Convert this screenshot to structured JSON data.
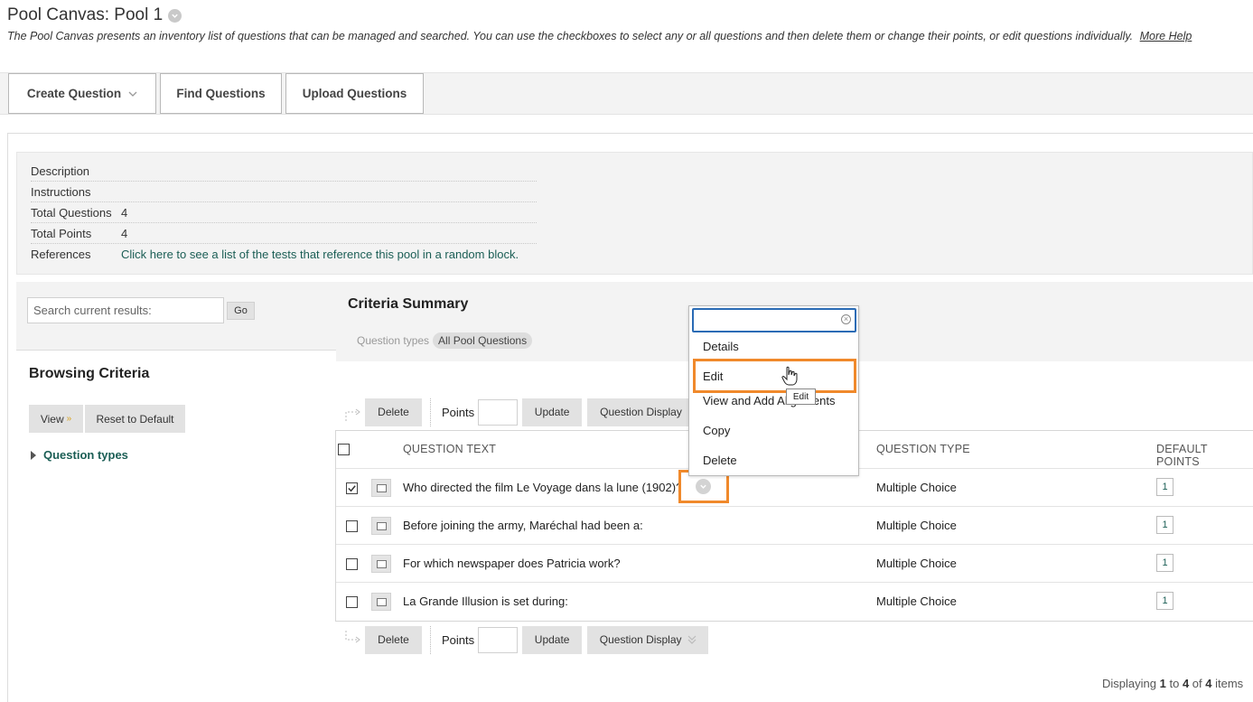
{
  "page": {
    "title": "Pool Canvas: Pool 1",
    "description": "The Pool Canvas presents an inventory list of questions that can be managed and searched. You can use the checkboxes to select any or all questions and then delete them or change their points, or edit questions individually.",
    "more_help": "More Help"
  },
  "toolbar": {
    "create_question": "Create Question",
    "find_questions": "Find Questions",
    "upload_questions": "Upload Questions"
  },
  "info": {
    "description_label": "Description",
    "instructions_label": "Instructions",
    "total_questions_label": "Total Questions",
    "total_questions_value": "4",
    "total_points_label": "Total Points",
    "total_points_value": "4",
    "references_label": "References",
    "references_link": "Click here to see a list of the tests that reference this pool in a random block."
  },
  "search": {
    "placeholder": "Search current results:",
    "go_label": "Go"
  },
  "browsing": {
    "title": "Browsing Criteria",
    "view_label": "View",
    "reset_label": "Reset to Default",
    "question_types_label": "Question types"
  },
  "criteria": {
    "title": "Criteria Summary",
    "question_types_label": "Question types",
    "question_types_value": "All Pool Questions"
  },
  "actions": {
    "delete_label": "Delete",
    "points_label": "Points",
    "update_label": "Update",
    "question_display_label": "Question Display"
  },
  "table": {
    "headers": {
      "question_text": "QUESTION TEXT",
      "question_type": "QUESTION TYPE",
      "default_points": "DEFAULT POINTS"
    },
    "rows": [
      {
        "text": "Who directed the film Le Voyage dans la lune (1902)?",
        "type": "Multiple Choice",
        "points": "1",
        "checked": true
      },
      {
        "text": "Before joining the army, Maréchal had been a:",
        "type": "Multiple Choice",
        "points": "1",
        "checked": false
      },
      {
        "text": "For which newspaper does Patricia work?",
        "type": "Multiple Choice",
        "points": "1",
        "checked": false
      },
      {
        "text": "La Grande Illusion is set during:",
        "type": "Multiple Choice",
        "points": "1",
        "checked": false
      }
    ]
  },
  "context_menu": {
    "items": [
      "Details",
      "Edit",
      "View and Add Alignments",
      "Copy",
      "Delete"
    ],
    "tooltip": "Edit"
  },
  "footer": {
    "prefix": "Displaying",
    "from": "1",
    "to_word": "to",
    "to": "4",
    "of_word": "of",
    "total": "4",
    "suffix": "items"
  },
  "colors": {
    "accent_link": "#1b5e55",
    "highlight": "#f0892b",
    "focus": "#2a6bb5"
  }
}
